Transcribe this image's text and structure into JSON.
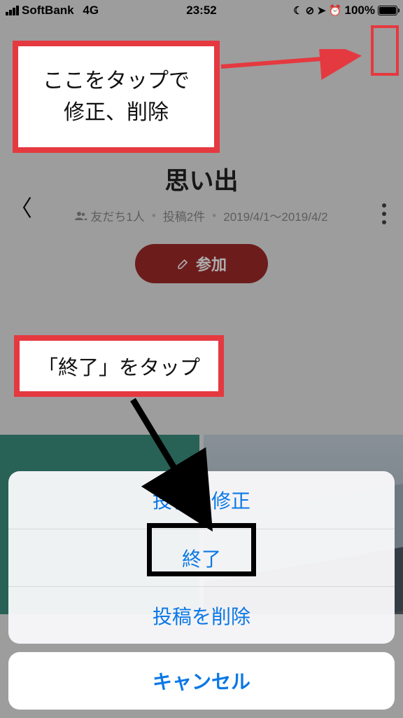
{
  "status": {
    "carrier": "SoftBank",
    "network": "4G",
    "time": "23:52",
    "battery_pct": "100%"
  },
  "header": {
    "title": "思い出",
    "friends": "友だち1人",
    "posts": "投稿2件",
    "date_range": "2019/4/1〜2019/4/2",
    "join_label": "参加"
  },
  "annotations": {
    "top": "ここをタップで\n修正、削除",
    "mid": "「終了」をタップ"
  },
  "sheet": {
    "items": [
      "投稿を修正",
      "終了",
      "投稿を削除"
    ],
    "cancel": "キャンセル"
  }
}
